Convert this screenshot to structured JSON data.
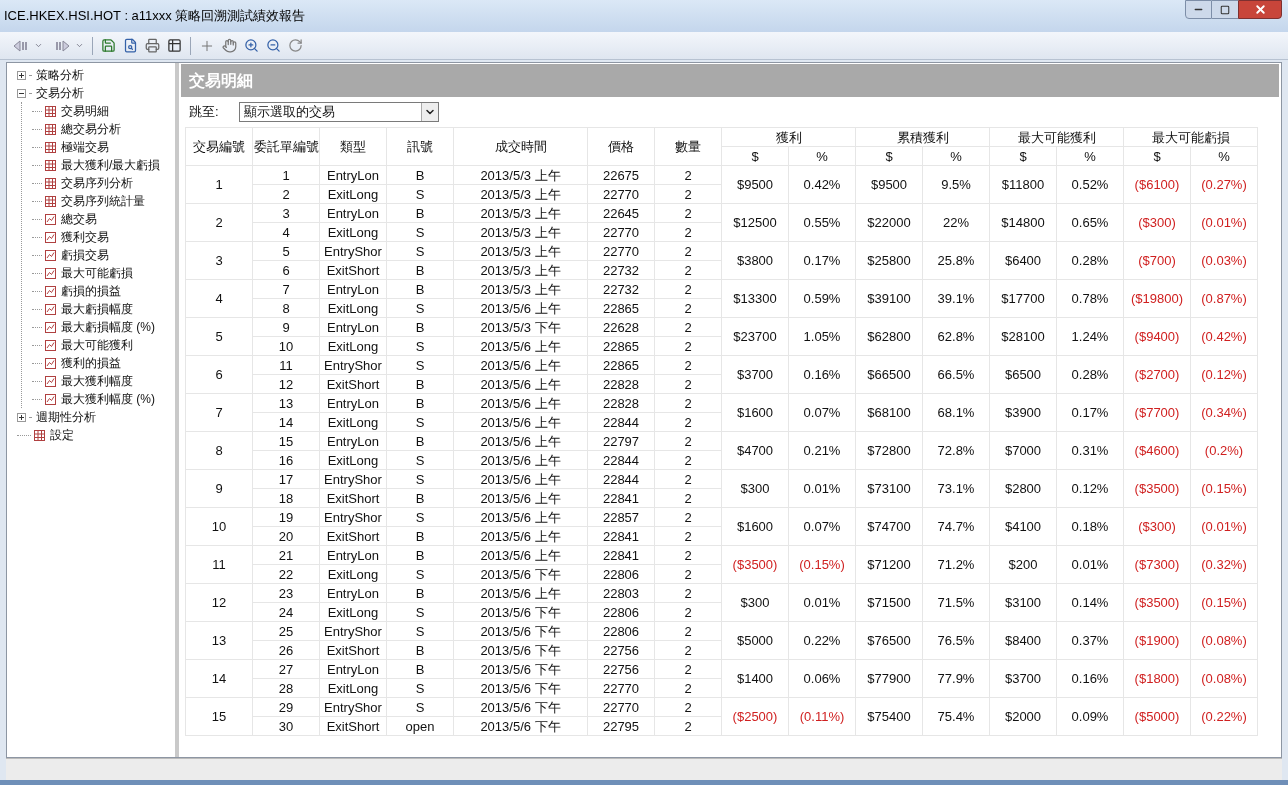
{
  "window": {
    "title": "ICE.HKEX.HSI.HOT : a11xxx 策略回溯測試績效報告"
  },
  "sidebar": {
    "items": [
      {
        "label": "策略分析",
        "kind": "folder",
        "expanded": false
      },
      {
        "label": "交易分析",
        "kind": "folder",
        "expanded": true,
        "children": [
          {
            "label": "交易明細",
            "kind": "table"
          },
          {
            "label": "總交易分析",
            "kind": "table"
          },
          {
            "label": "極端交易",
            "kind": "table"
          },
          {
            "label": "最大獲利/最大虧損",
            "kind": "table"
          },
          {
            "label": "交易序列分析",
            "kind": "table"
          },
          {
            "label": "交易序列統計量",
            "kind": "table"
          },
          {
            "label": "總交易",
            "kind": "chart"
          },
          {
            "label": "獲利交易",
            "kind": "chart"
          },
          {
            "label": "虧損交易",
            "kind": "chart"
          },
          {
            "label": "最大可能虧損",
            "kind": "chart"
          },
          {
            "label": "虧損的損益",
            "kind": "chart"
          },
          {
            "label": "最大虧損幅度",
            "kind": "chart"
          },
          {
            "label": "最大虧損幅度 (%)",
            "kind": "chart"
          },
          {
            "label": "最大可能獲利",
            "kind": "chart"
          },
          {
            "label": "獲利的損益",
            "kind": "chart"
          },
          {
            "label": "最大獲利幅度",
            "kind": "chart"
          },
          {
            "label": "最大獲利幅度 (%)",
            "kind": "chart"
          }
        ]
      },
      {
        "label": "週期性分析",
        "kind": "folder",
        "expanded": false
      },
      {
        "label": "設定",
        "kind": "table"
      }
    ]
  },
  "panel": {
    "title": "交易明細",
    "jump_label": "跳至:",
    "jump_value": "顯示選取的交易"
  },
  "table": {
    "columns": [
      "交易編號",
      "委託單編號",
      "類型",
      "訊號",
      "成交時間",
      "價格",
      "數量"
    ],
    "groups": [
      {
        "label": "獲利",
        "sub": [
          "$",
          "%"
        ]
      },
      {
        "label": "累積獲利",
        "sub": [
          "$",
          "%"
        ]
      },
      {
        "label": "最大可能獲利",
        "sub": [
          "$",
          "%"
        ]
      },
      {
        "label": "最大可能虧損",
        "sub": [
          "$",
          "%"
        ]
      }
    ],
    "trades": [
      {
        "no": "1",
        "orders": [
          {
            "no": "1",
            "type": "EntryLon",
            "signal": "B",
            "time": "2013/5/3 上午",
            "price": "22675",
            "qty": "2"
          },
          {
            "no": "2",
            "type": "ExitLong",
            "signal": "S",
            "time": "2013/5/3 上午",
            "price": "22770",
            "qty": "2"
          }
        ],
        "metrics": [
          {
            "amount": "$9500",
            "pct": "0.42%",
            "loss": false
          },
          {
            "amount": "$9500",
            "pct": "9.5%",
            "loss": false
          },
          {
            "amount": "$11800",
            "pct": "0.52%",
            "loss": false
          },
          {
            "amount": "($6100)",
            "pct": "(0.27%)",
            "loss": true
          }
        ]
      },
      {
        "no": "2",
        "orders": [
          {
            "no": "3",
            "type": "EntryLon",
            "signal": "B",
            "time": "2013/5/3 上午",
            "price": "22645",
            "qty": "2"
          },
          {
            "no": "4",
            "type": "ExitLong",
            "signal": "S",
            "time": "2013/5/3 上午",
            "price": "22770",
            "qty": "2"
          }
        ],
        "metrics": [
          {
            "amount": "$12500",
            "pct": "0.55%",
            "loss": false
          },
          {
            "amount": "$22000",
            "pct": "22%",
            "loss": false
          },
          {
            "amount": "$14800",
            "pct": "0.65%",
            "loss": false
          },
          {
            "amount": "($300)",
            "pct": "(0.01%)",
            "loss": true
          }
        ]
      },
      {
        "no": "3",
        "orders": [
          {
            "no": "5",
            "type": "EntryShor",
            "signal": "S",
            "time": "2013/5/3 上午",
            "price": "22770",
            "qty": "2"
          },
          {
            "no": "6",
            "type": "ExitShort",
            "signal": "B",
            "time": "2013/5/3 上午",
            "price": "22732",
            "qty": "2"
          }
        ],
        "metrics": [
          {
            "amount": "$3800",
            "pct": "0.17%",
            "loss": false
          },
          {
            "amount": "$25800",
            "pct": "25.8%",
            "loss": false
          },
          {
            "amount": "$6400",
            "pct": "0.28%",
            "loss": false
          },
          {
            "amount": "($700)",
            "pct": "(0.03%)",
            "loss": true
          }
        ]
      },
      {
        "no": "4",
        "orders": [
          {
            "no": "7",
            "type": "EntryLon",
            "signal": "B",
            "time": "2013/5/3 上午",
            "price": "22732",
            "qty": "2"
          },
          {
            "no": "8",
            "type": "ExitLong",
            "signal": "S",
            "time": "2013/5/6 上午",
            "price": "22865",
            "qty": "2"
          }
        ],
        "metrics": [
          {
            "amount": "$13300",
            "pct": "0.59%",
            "loss": false
          },
          {
            "amount": "$39100",
            "pct": "39.1%",
            "loss": false
          },
          {
            "amount": "$17700",
            "pct": "0.78%",
            "loss": false
          },
          {
            "amount": "($19800)",
            "pct": "(0.87%)",
            "loss": true
          }
        ]
      },
      {
        "no": "5",
        "orders": [
          {
            "no": "9",
            "type": "EntryLon",
            "signal": "B",
            "time": "2013/5/3 下午",
            "price": "22628",
            "qty": "2"
          },
          {
            "no": "10",
            "type": "ExitLong",
            "signal": "S",
            "time": "2013/5/6 上午",
            "price": "22865",
            "qty": "2"
          }
        ],
        "metrics": [
          {
            "amount": "$23700",
            "pct": "1.05%",
            "loss": false
          },
          {
            "amount": "$62800",
            "pct": "62.8%",
            "loss": false
          },
          {
            "amount": "$28100",
            "pct": "1.24%",
            "loss": false
          },
          {
            "amount": "($9400)",
            "pct": "(0.42%)",
            "loss": true
          }
        ]
      },
      {
        "no": "6",
        "orders": [
          {
            "no": "11",
            "type": "EntryShor",
            "signal": "S",
            "time": "2013/5/6 上午",
            "price": "22865",
            "qty": "2"
          },
          {
            "no": "12",
            "type": "ExitShort",
            "signal": "B",
            "time": "2013/5/6 上午",
            "price": "22828",
            "qty": "2"
          }
        ],
        "metrics": [
          {
            "amount": "$3700",
            "pct": "0.16%",
            "loss": false
          },
          {
            "amount": "$66500",
            "pct": "66.5%",
            "loss": false
          },
          {
            "amount": "$6500",
            "pct": "0.28%",
            "loss": false
          },
          {
            "amount": "($2700)",
            "pct": "(0.12%)",
            "loss": true
          }
        ]
      },
      {
        "no": "7",
        "orders": [
          {
            "no": "13",
            "type": "EntryLon",
            "signal": "B",
            "time": "2013/5/6 上午",
            "price": "22828",
            "qty": "2"
          },
          {
            "no": "14",
            "type": "ExitLong",
            "signal": "S",
            "time": "2013/5/6 上午",
            "price": "22844",
            "qty": "2"
          }
        ],
        "metrics": [
          {
            "amount": "$1600",
            "pct": "0.07%",
            "loss": false
          },
          {
            "amount": "$68100",
            "pct": "68.1%",
            "loss": false
          },
          {
            "amount": "$3900",
            "pct": "0.17%",
            "loss": false
          },
          {
            "amount": "($7700)",
            "pct": "(0.34%)",
            "loss": true
          }
        ]
      },
      {
        "no": "8",
        "orders": [
          {
            "no": "15",
            "type": "EntryLon",
            "signal": "B",
            "time": "2013/5/6 上午",
            "price": "22797",
            "qty": "2"
          },
          {
            "no": "16",
            "type": "ExitLong",
            "signal": "S",
            "time": "2013/5/6 上午",
            "price": "22844",
            "qty": "2"
          }
        ],
        "metrics": [
          {
            "amount": "$4700",
            "pct": "0.21%",
            "loss": false
          },
          {
            "amount": "$72800",
            "pct": "72.8%",
            "loss": false
          },
          {
            "amount": "$7000",
            "pct": "0.31%",
            "loss": false
          },
          {
            "amount": "($4600)",
            "pct": "(0.2%)",
            "loss": true
          }
        ]
      },
      {
        "no": "9",
        "orders": [
          {
            "no": "17",
            "type": "EntryShor",
            "signal": "S",
            "time": "2013/5/6 上午",
            "price": "22844",
            "qty": "2"
          },
          {
            "no": "18",
            "type": "ExitShort",
            "signal": "B",
            "time": "2013/5/6 上午",
            "price": "22841",
            "qty": "2"
          }
        ],
        "metrics": [
          {
            "amount": "$300",
            "pct": "0.01%",
            "loss": false
          },
          {
            "amount": "$73100",
            "pct": "73.1%",
            "loss": false
          },
          {
            "amount": "$2800",
            "pct": "0.12%",
            "loss": false
          },
          {
            "amount": "($3500)",
            "pct": "(0.15%)",
            "loss": true
          }
        ]
      },
      {
        "no": "10",
        "orders": [
          {
            "no": "19",
            "type": "EntryShor",
            "signal": "S",
            "time": "2013/5/6 上午",
            "price": "22857",
            "qty": "2"
          },
          {
            "no": "20",
            "type": "ExitShort",
            "signal": "B",
            "time": "2013/5/6 上午",
            "price": "22841",
            "qty": "2"
          }
        ],
        "metrics": [
          {
            "amount": "$1600",
            "pct": "0.07%",
            "loss": false
          },
          {
            "amount": "$74700",
            "pct": "74.7%",
            "loss": false
          },
          {
            "amount": "$4100",
            "pct": "0.18%",
            "loss": false
          },
          {
            "amount": "($300)",
            "pct": "(0.01%)",
            "loss": true
          }
        ]
      },
      {
        "no": "11",
        "orders": [
          {
            "no": "21",
            "type": "EntryLon",
            "signal": "B",
            "time": "2013/5/6 上午",
            "price": "22841",
            "qty": "2"
          },
          {
            "no": "22",
            "type": "ExitLong",
            "signal": "S",
            "time": "2013/5/6 下午",
            "price": "22806",
            "qty": "2"
          }
        ],
        "metrics": [
          {
            "amount": "($3500)",
            "pct": "(0.15%)",
            "loss": true
          },
          {
            "amount": "$71200",
            "pct": "71.2%",
            "loss": false
          },
          {
            "amount": "$200",
            "pct": "0.01%",
            "loss": false
          },
          {
            "amount": "($7300)",
            "pct": "(0.32%)",
            "loss": true
          }
        ]
      },
      {
        "no": "12",
        "orders": [
          {
            "no": "23",
            "type": "EntryLon",
            "signal": "B",
            "time": "2013/5/6 上午",
            "price": "22803",
            "qty": "2"
          },
          {
            "no": "24",
            "type": "ExitLong",
            "signal": "S",
            "time": "2013/5/6 下午",
            "price": "22806",
            "qty": "2"
          }
        ],
        "metrics": [
          {
            "amount": "$300",
            "pct": "0.01%",
            "loss": false
          },
          {
            "amount": "$71500",
            "pct": "71.5%",
            "loss": false
          },
          {
            "amount": "$3100",
            "pct": "0.14%",
            "loss": false
          },
          {
            "amount": "($3500)",
            "pct": "(0.15%)",
            "loss": true
          }
        ]
      },
      {
        "no": "13",
        "orders": [
          {
            "no": "25",
            "type": "EntryShor",
            "signal": "S",
            "time": "2013/5/6 下午",
            "price": "22806",
            "qty": "2"
          },
          {
            "no": "26",
            "type": "ExitShort",
            "signal": "B",
            "time": "2013/5/6 下午",
            "price": "22756",
            "qty": "2"
          }
        ],
        "metrics": [
          {
            "amount": "$5000",
            "pct": "0.22%",
            "loss": false
          },
          {
            "amount": "$76500",
            "pct": "76.5%",
            "loss": false
          },
          {
            "amount": "$8400",
            "pct": "0.37%",
            "loss": false
          },
          {
            "amount": "($1900)",
            "pct": "(0.08%)",
            "loss": true
          }
        ]
      },
      {
        "no": "14",
        "orders": [
          {
            "no": "27",
            "type": "EntryLon",
            "signal": "B",
            "time": "2013/5/6 下午",
            "price": "22756",
            "qty": "2"
          },
          {
            "no": "28",
            "type": "ExitLong",
            "signal": "S",
            "time": "2013/5/6 下午",
            "price": "22770",
            "qty": "2"
          }
        ],
        "metrics": [
          {
            "amount": "$1400",
            "pct": "0.06%",
            "loss": false
          },
          {
            "amount": "$77900",
            "pct": "77.9%",
            "loss": false
          },
          {
            "amount": "$3700",
            "pct": "0.16%",
            "loss": false
          },
          {
            "amount": "($1800)",
            "pct": "(0.08%)",
            "loss": true
          }
        ]
      },
      {
        "no": "15",
        "orders": [
          {
            "no": "29",
            "type": "EntryShor",
            "signal": "S",
            "time": "2013/5/6 下午",
            "price": "22770",
            "qty": "2"
          },
          {
            "no": "30",
            "type": "ExitShort",
            "signal": "open",
            "time": "2013/5/6 下午",
            "price": "22795",
            "qty": "2"
          }
        ],
        "metrics": [
          {
            "amount": "($2500)",
            "pct": "(0.11%)",
            "loss": true
          },
          {
            "amount": "$75400",
            "pct": "75.4%",
            "loss": false
          },
          {
            "amount": "$2000",
            "pct": "0.09%",
            "loss": false
          },
          {
            "amount": "($5000)",
            "pct": "(0.22%)",
            "loss": true
          }
        ]
      }
    ]
  }
}
